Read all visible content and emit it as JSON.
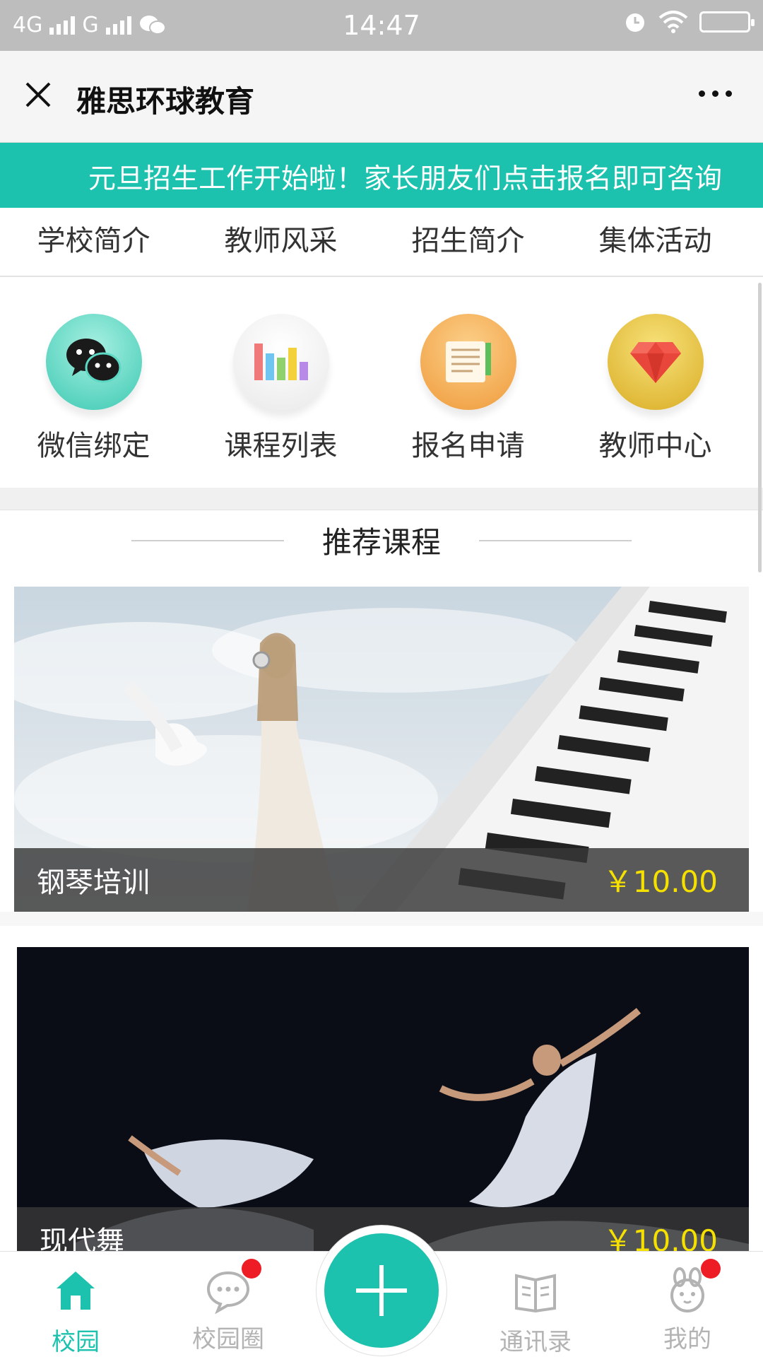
{
  "status_bar": {
    "network1": "4G",
    "network2": "G",
    "time": "14:47"
  },
  "title_bar": {
    "title": "雅思环球教育"
  },
  "banner": {
    "text": "元旦招生工作开始啦！家长朋友们点击报名即可咨询"
  },
  "tabs": [
    {
      "label": "学校简介"
    },
    {
      "label": "教师风采"
    },
    {
      "label": "招生简介"
    },
    {
      "label": "集体活动"
    }
  ],
  "grid": [
    {
      "label": "微信绑定",
      "icon": "wechat-icon",
      "color": "#5cd8c4"
    },
    {
      "label": "课程列表",
      "icon": "bar-chart-icon",
      "color": "#f2f2f2"
    },
    {
      "label": "报名申请",
      "icon": "document-icon",
      "color": "#f2a84a"
    },
    {
      "label": "教师中心",
      "icon": "diamond-icon",
      "color": "#e6c23c"
    }
  ],
  "section": {
    "title": "推荐课程"
  },
  "courses": [
    {
      "name": "钢琴培训",
      "price": "￥10.00"
    },
    {
      "name": "现代舞",
      "price": "￥10.00"
    }
  ],
  "bottom_nav": [
    {
      "label": "校园",
      "icon": "home-icon",
      "active": true
    },
    {
      "label": "校园圈",
      "icon": "chat-bubble-icon",
      "badge": true
    },
    {
      "label": "通讯录",
      "icon": "book-icon"
    },
    {
      "label": "我的",
      "icon": "rabbit-icon",
      "badge": true
    }
  ],
  "colors": {
    "accent": "#1cc2ad",
    "price": "#f5e000",
    "badge": "#ee1c25",
    "status_bar": "#bdbdbd"
  }
}
